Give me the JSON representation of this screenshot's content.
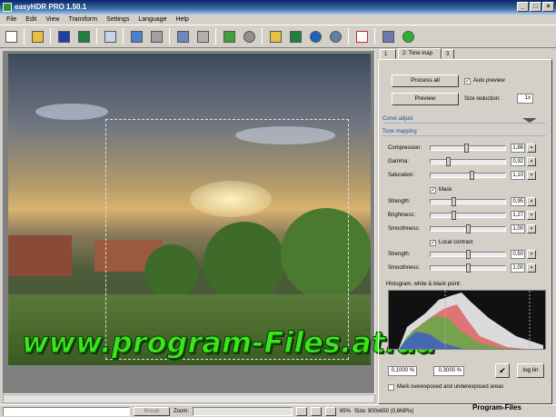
{
  "window": {
    "title": "easyHDR PRO 1.50.1",
    "min": "_",
    "max": "□",
    "close": "×"
  },
  "menu": [
    "File",
    "Edit",
    "View",
    "Transform",
    "Settings",
    "Language",
    "Help"
  ],
  "toolbar_icons": [
    "new-icon",
    "open-icon",
    "save-icon",
    "save-as-icon",
    "copy-icon",
    "back-icon",
    "forward-icon",
    "grid-icon",
    "images-icon",
    "refresh-icon",
    "stop-icon",
    "folder-open-icon",
    "save-green-icon",
    "undo-icon",
    "redo-icon",
    "checklist-icon",
    "home-icon",
    "go-icon"
  ],
  "tabs": [
    "1",
    "2: Tone map",
    "3"
  ],
  "panel": {
    "process_all": "Process all",
    "auto_preview": "Auto preview",
    "preview": "Preview",
    "size_reduction_label": "Size reduction:",
    "size_reduction_value": "1x",
    "curve_adjust": "Curve adjust",
    "tone_mapping": "Tone mapping",
    "mask": "Mask",
    "local_contrast": "Local contrast",
    "histogram_label": "Histogram, white & black point:",
    "black_point": "0,1000 %",
    "white_point": "0,3000 %",
    "loglin": "log lin",
    "mark_over": "Mark overexposed and underexposed areas"
  },
  "sliders": [
    {
      "label": "Compression:",
      "value": "1,86",
      "pos": 0.47
    },
    {
      "label": "Gamma:",
      "value": "0,92",
      "pos": 0.22
    },
    {
      "label": "Saturation:",
      "value": "1,10",
      "pos": 0.55
    },
    {
      "label": "Strength:",
      "value": "0,95",
      "pos": 0.3
    },
    {
      "label": "Brightness:",
      "value": "1,27",
      "pos": 0.3
    },
    {
      "label": "Smoothness:",
      "value": "1,00",
      "pos": 0.5
    },
    {
      "label": "Strength:",
      "value": "0,50",
      "pos": 0.5
    },
    {
      "label": "Smoothness:",
      "value": "1,00",
      "pos": 0.5
    }
  ],
  "status": {
    "break": "Break",
    "zoom_label": "Zoom:",
    "zoom_value": "85%",
    "size": "Size: 900x650 (0,6MPix)"
  },
  "watermark": "www.program-Files.at.ua",
  "brand": "Program-Files"
}
